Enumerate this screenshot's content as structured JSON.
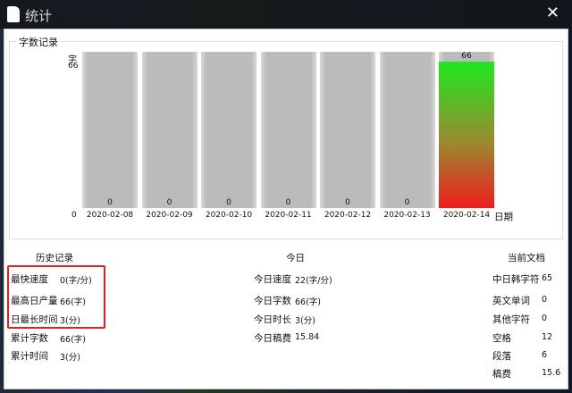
{
  "window": {
    "title": "统计",
    "close_icon": "close-icon"
  },
  "chart_data": {
    "type": "bar",
    "title": "字数记录",
    "ylabel": "字",
    "xlabel": "日期",
    "y_min_label": "0",
    "y_max_label": "66",
    "ylim": [
      0,
      66
    ],
    "categories": [
      "2020-02-08",
      "2020-02-09",
      "2020-02-10",
      "2020-02-11",
      "2020-02-12",
      "2020-02-13",
      "2020-02-14"
    ],
    "values": [
      0,
      0,
      0,
      0,
      0,
      0,
      66
    ],
    "highlight_color_top": "#1ee81e",
    "highlight_color_bottom": "#f01c1c"
  },
  "history": {
    "title": "历史记录",
    "rows": [
      {
        "label": "最快速度",
        "value": "0(字/分)"
      },
      {
        "label": "最高日产量",
        "value": "66(字)"
      },
      {
        "label": "日最长时间",
        "value": "3(分)"
      },
      {
        "label": "累计字数",
        "value": "66(字)"
      },
      {
        "label": "累计时间",
        "value": "3(分)"
      }
    ]
  },
  "today": {
    "title": "今日",
    "rows": [
      {
        "label": "今日速度",
        "value": "22(字/分)"
      },
      {
        "label": "今日字数",
        "value": "66(字)"
      },
      {
        "label": "今日时长",
        "value": "3(分)"
      },
      {
        "label": "今日稿费",
        "value": "15.84"
      }
    ]
  },
  "current_doc": {
    "title": "当前文档",
    "rows": [
      {
        "label": "中日韩字符",
        "value": "65"
      },
      {
        "label": "英文单词",
        "value": "0"
      },
      {
        "label": "其他字符",
        "value": "0"
      },
      {
        "label": "空格",
        "value": "12"
      },
      {
        "label": "段落",
        "value": "6"
      },
      {
        "label": "稿费",
        "value": "15.6"
      }
    ]
  }
}
